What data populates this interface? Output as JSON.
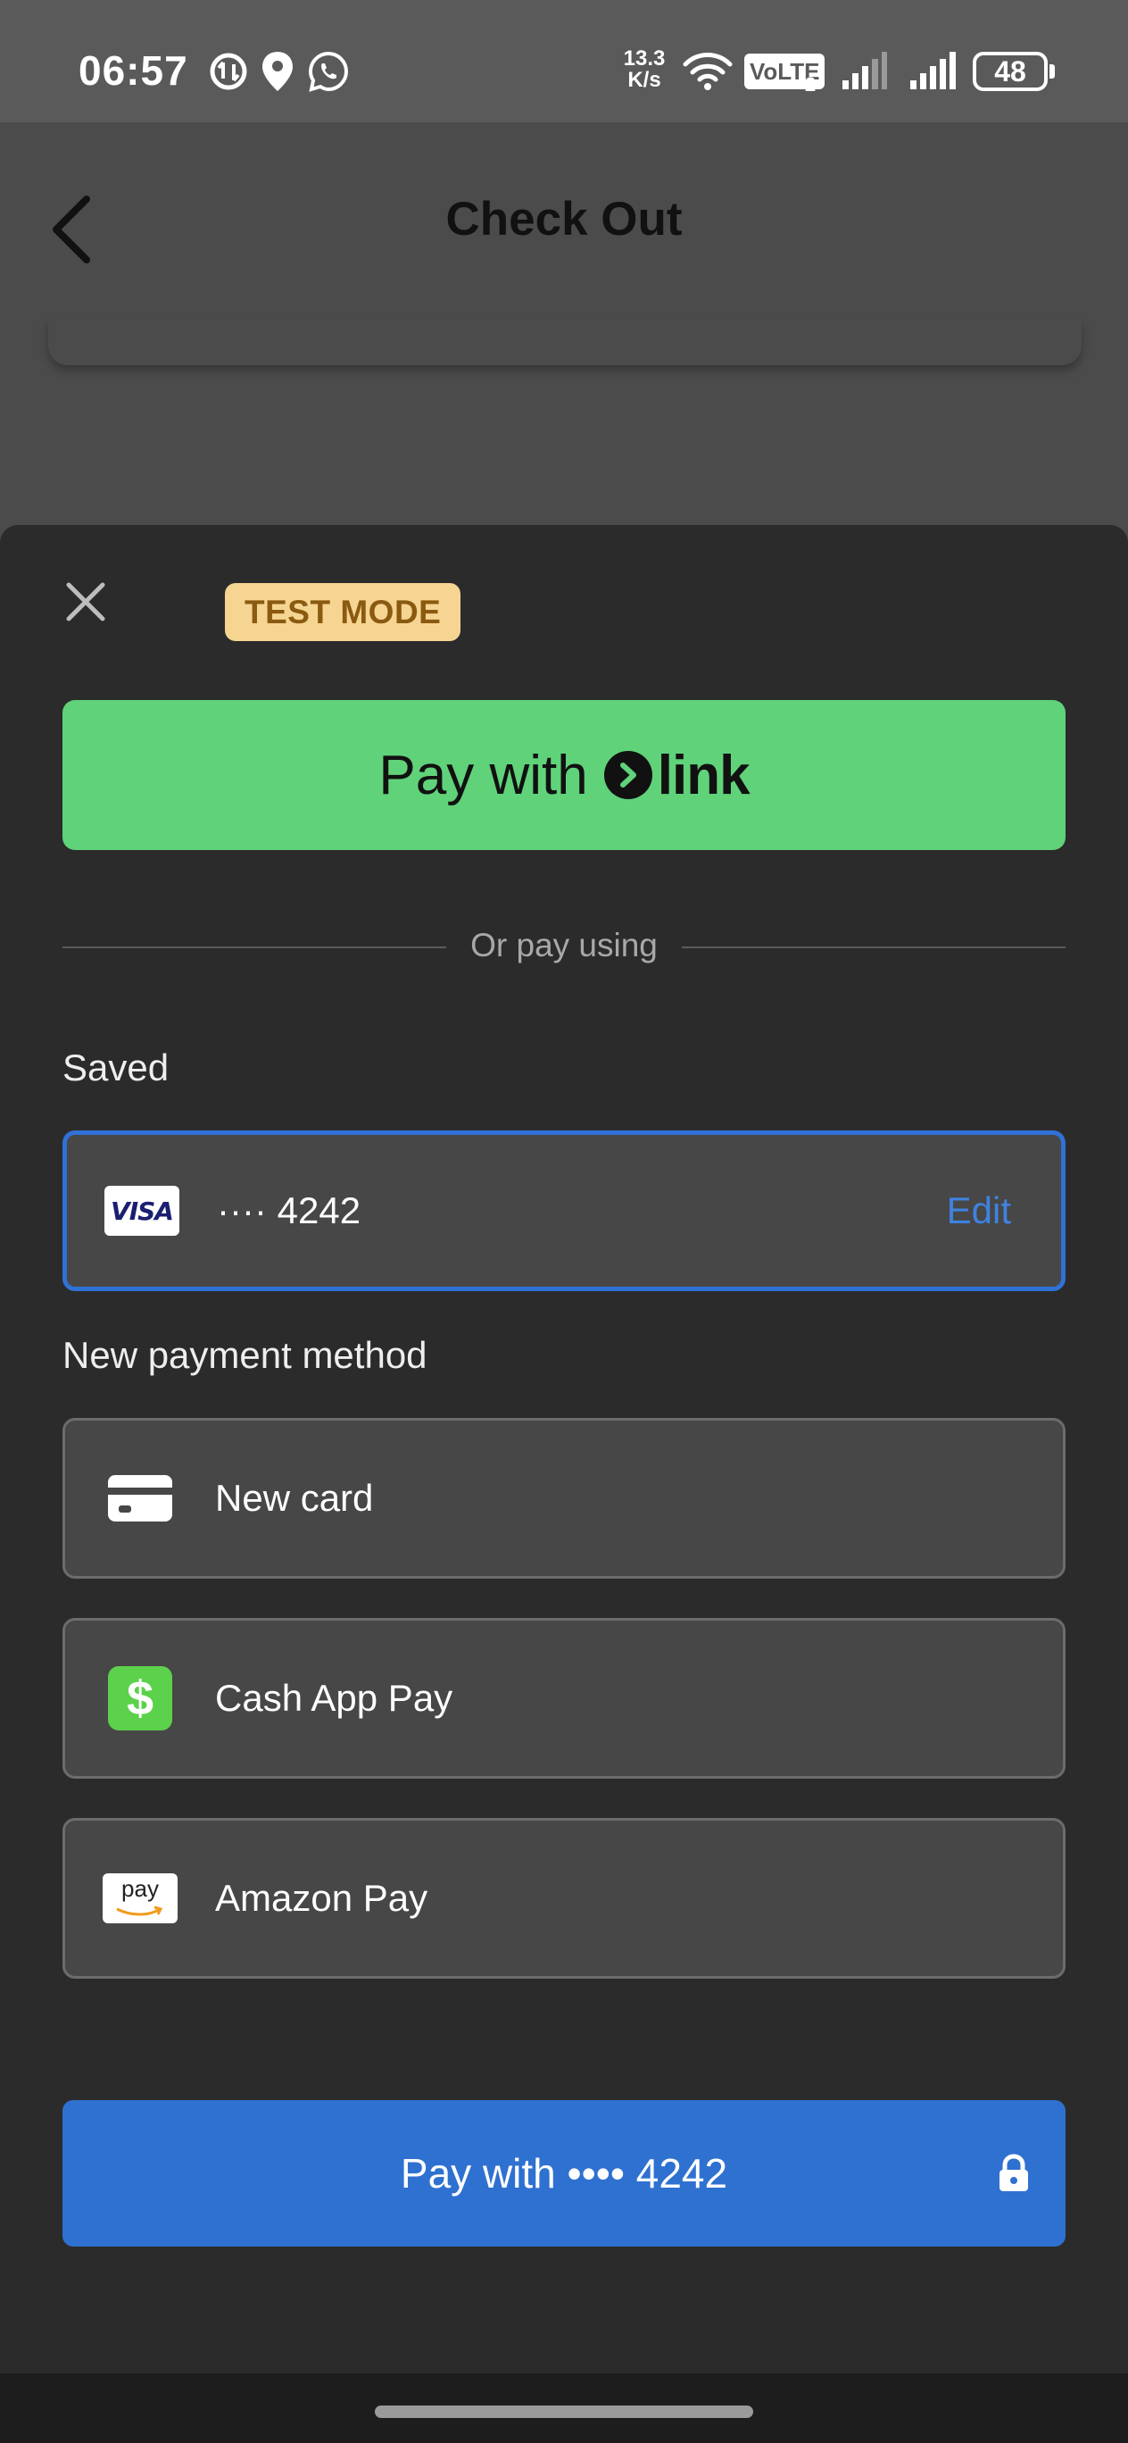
{
  "status_bar": {
    "time": "06:57",
    "net_speed_top": "13.3",
    "net_speed_bottom": "K/s",
    "volte": "VoLTE",
    "volte_sub": "2",
    "battery": "48",
    "icons": [
      "data-saver-icon",
      "location-icon",
      "whatsapp-icon",
      "wifi-icon",
      "signal-icon",
      "signal-icon",
      "battery-icon"
    ]
  },
  "app_bar": {
    "title": "Check Out",
    "back_icon": "chevron-left-icon"
  },
  "sheet": {
    "close_icon": "close-icon",
    "badge": "TEST MODE",
    "link_button": {
      "prefix": "Pay with",
      "brand": "link"
    },
    "divider_text": "Or pay using",
    "saved_label": "Saved",
    "saved_card": {
      "brand": "VISA",
      "masked": "···· 4242",
      "edit": "Edit"
    },
    "new_method_label": "New payment method",
    "methods": [
      {
        "label": "New card",
        "icon": "card-icon"
      },
      {
        "label": "Cash App Pay",
        "icon": "cash-app-icon",
        "glyph": "$"
      },
      {
        "label": "Amazon Pay",
        "icon": "amazon-pay-icon",
        "glyph": "pay"
      }
    ],
    "pay_button": "Pay with •••• 4242",
    "lock_icon": "lock-icon"
  },
  "colors": {
    "link_green": "#60d27a",
    "primary_blue": "#2f71d0",
    "badge_bg": "#f6d592",
    "sheet_bg": "#2b2b2b"
  }
}
